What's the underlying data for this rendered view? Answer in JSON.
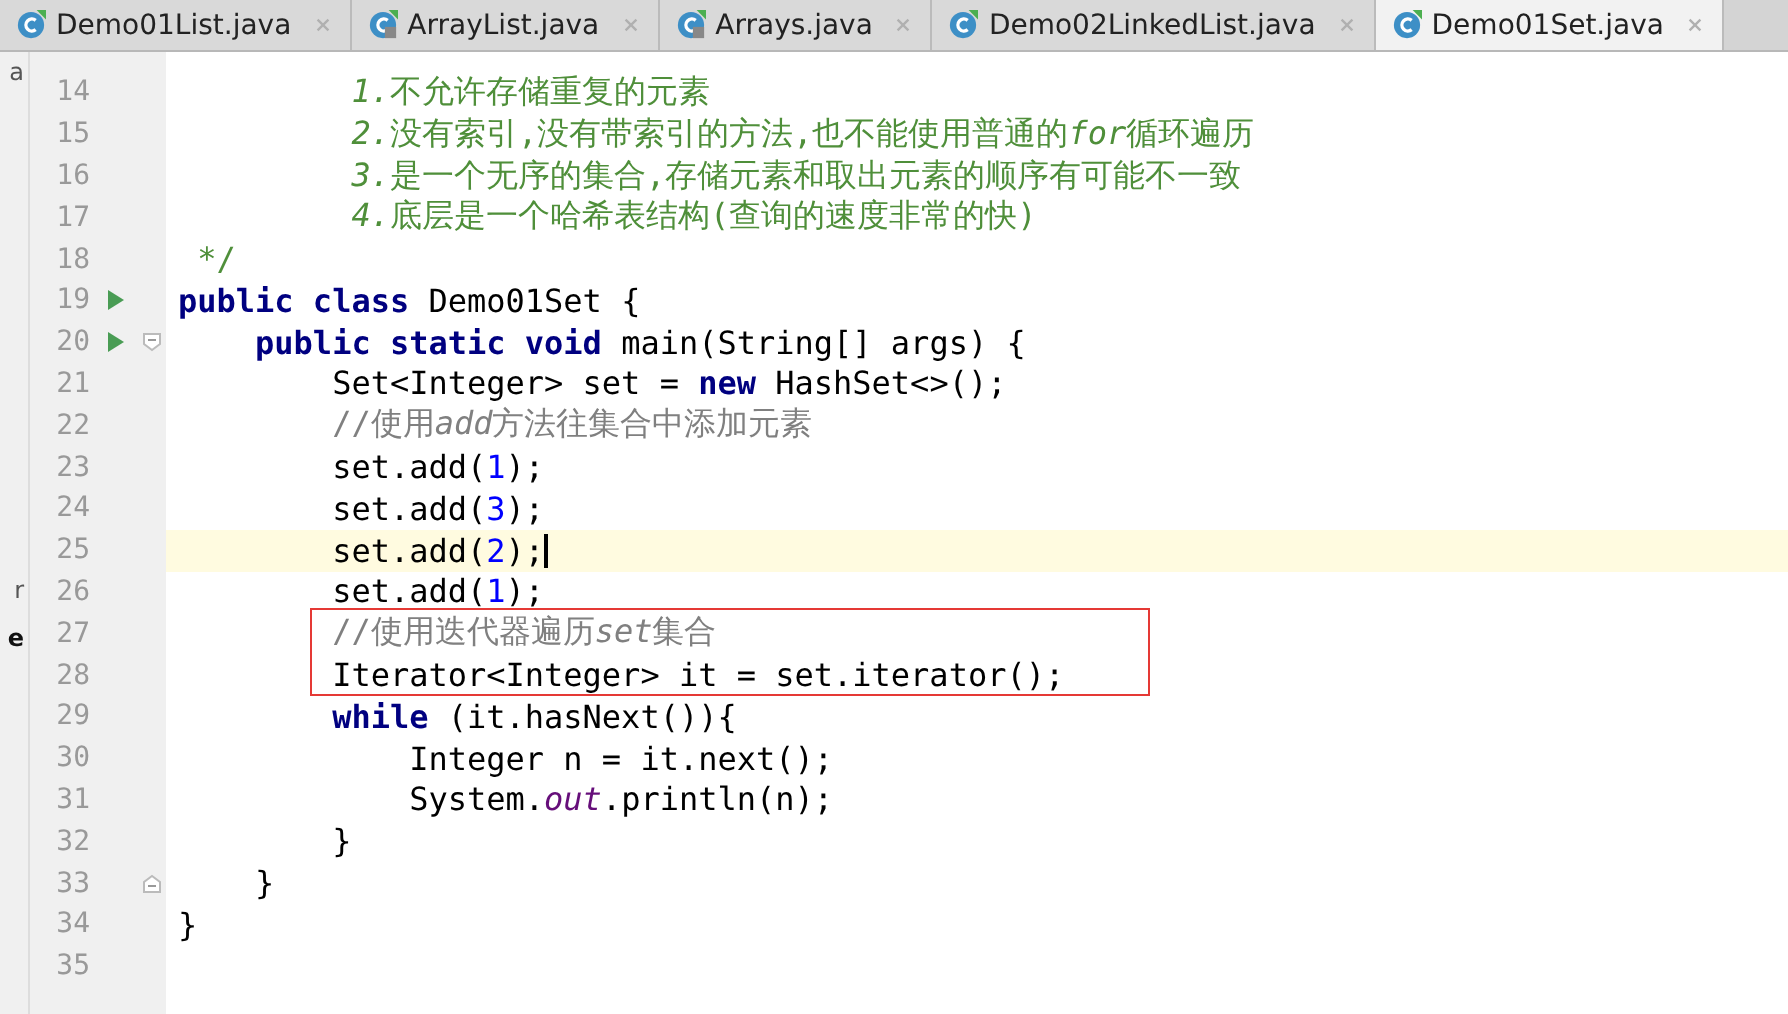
{
  "tabs": [
    {
      "label": "Demo01List.java",
      "locked": false,
      "selected": false
    },
    {
      "label": "ArrayList.java",
      "locked": true,
      "selected": false
    },
    {
      "label": "Arrays.java",
      "locked": true,
      "selected": false
    },
    {
      "label": "Demo02LinkedList.java",
      "locked": false,
      "selected": false
    },
    {
      "label": "Demo01Set.java",
      "locked": false,
      "selected": true
    }
  ],
  "sidebar_fragments": [
    "a",
    "r",
    "e"
  ],
  "lines": [
    {
      "number": "14",
      "run_marker": false,
      "current": false,
      "fold_start": false,
      "fold_end": false,
      "tokens": [
        {
          "t": "         1.",
          "kind": "doc_italic"
        },
        {
          "t": "不允许存储重复的元素",
          "kind": "doc"
        }
      ]
    },
    {
      "number": "15",
      "run_marker": false,
      "current": false,
      "fold_start": false,
      "fold_end": false,
      "tokens": [
        {
          "t": "         2.",
          "kind": "doc_italic"
        },
        {
          "t": "没有索引,没有带索引的方法,也不能使用普通的",
          "kind": "doc"
        },
        {
          "t": "for",
          "kind": "doc_italic"
        },
        {
          "t": "循环遍历",
          "kind": "doc"
        }
      ]
    },
    {
      "number": "16",
      "run_marker": false,
      "current": false,
      "fold_start": false,
      "fold_end": false,
      "tokens": [
        {
          "t": "         3.",
          "kind": "doc_italic"
        },
        {
          "t": "是一个无序的集合,存储元素和取出元素的顺序有可能不一致",
          "kind": "doc"
        }
      ]
    },
    {
      "number": "17",
      "run_marker": false,
      "current": false,
      "fold_start": false,
      "fold_end": false,
      "tokens": [
        {
          "t": "         4.",
          "kind": "doc_italic"
        },
        {
          "t": "底层是一个哈希表结构(查询的速度非常的快)",
          "kind": "doc"
        }
      ]
    },
    {
      "number": "18",
      "run_marker": false,
      "current": false,
      "fold_start": false,
      "fold_end": false,
      "tokens": [
        {
          "t": " */",
          "kind": "doc"
        }
      ]
    },
    {
      "number": "19",
      "run_marker": true,
      "current": false,
      "fold_start": false,
      "fold_end": false,
      "tokens": [
        {
          "t": "public class ",
          "kind": "keyword"
        },
        {
          "t": "Demo01Set {",
          "kind": "plain"
        }
      ]
    },
    {
      "number": "20",
      "run_marker": true,
      "current": false,
      "fold_start": true,
      "fold_end": false,
      "tokens": [
        {
          "t": "    public static void ",
          "kind": "keyword"
        },
        {
          "t": "main(String[] args) {",
          "kind": "plain"
        }
      ]
    },
    {
      "number": "21",
      "run_marker": false,
      "current": false,
      "fold_start": false,
      "fold_end": false,
      "tokens": [
        {
          "t": "        Set<Integer> set = ",
          "kind": "plain"
        },
        {
          "t": "new ",
          "kind": "keyword"
        },
        {
          "t": "HashSet<>();",
          "kind": "plain"
        }
      ]
    },
    {
      "number": "22",
      "run_marker": false,
      "current": false,
      "fold_start": false,
      "fold_end": false,
      "tokens": [
        {
          "t": "        //使用",
          "kind": "comment"
        },
        {
          "t": "add",
          "kind": "comment_italic"
        },
        {
          "t": "方法往集合中添加元素",
          "kind": "comment"
        }
      ]
    },
    {
      "number": "23",
      "run_marker": false,
      "current": false,
      "fold_start": false,
      "fold_end": false,
      "tokens": [
        {
          "t": "        set.add(",
          "kind": "plain"
        },
        {
          "t": "1",
          "kind": "number"
        },
        {
          "t": ");",
          "kind": "plain"
        }
      ]
    },
    {
      "number": "24",
      "run_marker": false,
      "current": false,
      "fold_start": false,
      "fold_end": false,
      "tokens": [
        {
          "t": "        set.add(",
          "kind": "plain"
        },
        {
          "t": "3",
          "kind": "number"
        },
        {
          "t": ");",
          "kind": "plain"
        }
      ]
    },
    {
      "number": "25",
      "run_marker": false,
      "current": true,
      "fold_start": false,
      "fold_end": false,
      "tokens": [
        {
          "t": "        set.add(",
          "kind": "plain"
        },
        {
          "t": "2",
          "kind": "number"
        },
        {
          "t": ");",
          "kind": "plain"
        }
      ]
    },
    {
      "number": "26",
      "run_marker": false,
      "current": false,
      "fold_start": false,
      "fold_end": false,
      "tokens": [
        {
          "t": "        set.add(",
          "kind": "plain"
        },
        {
          "t": "1",
          "kind": "number"
        },
        {
          "t": ");",
          "kind": "plain"
        }
      ]
    },
    {
      "number": "27",
      "run_marker": false,
      "current": false,
      "fold_start": false,
      "fold_end": false,
      "tokens": [
        {
          "t": "        //使用迭代器遍历",
          "kind": "comment"
        },
        {
          "t": "set",
          "kind": "comment_italic"
        },
        {
          "t": "集合",
          "kind": "comment"
        }
      ]
    },
    {
      "number": "28",
      "run_marker": false,
      "current": false,
      "fold_start": false,
      "fold_end": false,
      "tokens": [
        {
          "t": "        Iterator<Integer> it = set.iterator();",
          "kind": "plain"
        }
      ]
    },
    {
      "number": "29",
      "run_marker": false,
      "current": false,
      "fold_start": false,
      "fold_end": false,
      "tokens": [
        {
          "t": "        while ",
          "kind": "keyword"
        },
        {
          "t": "(it.hasNext()){",
          "kind": "plain"
        }
      ]
    },
    {
      "number": "30",
      "run_marker": false,
      "current": false,
      "fold_start": false,
      "fold_end": false,
      "tokens": [
        {
          "t": "            Integer n = it.next();",
          "kind": "plain"
        }
      ]
    },
    {
      "number": "31",
      "run_marker": false,
      "current": false,
      "fold_start": false,
      "fold_end": false,
      "tokens": [
        {
          "t": "            System.",
          "kind": "plain"
        },
        {
          "t": "out",
          "kind": "field"
        },
        {
          "t": ".println(n);",
          "kind": "plain"
        }
      ]
    },
    {
      "number": "32",
      "run_marker": false,
      "current": false,
      "fold_start": false,
      "fold_end": false,
      "tokens": [
        {
          "t": "        }",
          "kind": "plain"
        }
      ]
    },
    {
      "number": "33",
      "run_marker": false,
      "current": false,
      "fold_start": false,
      "fold_end": true,
      "tokens": [
        {
          "t": "    }",
          "kind": "plain"
        }
      ]
    },
    {
      "number": "34",
      "run_marker": false,
      "current": false,
      "fold_start": false,
      "fold_end": false,
      "tokens": [
        {
          "t": "}",
          "kind": "plain"
        }
      ]
    },
    {
      "number": "35",
      "run_marker": false,
      "current": false,
      "fold_start": false,
      "fold_end": false
    }
  ]
}
